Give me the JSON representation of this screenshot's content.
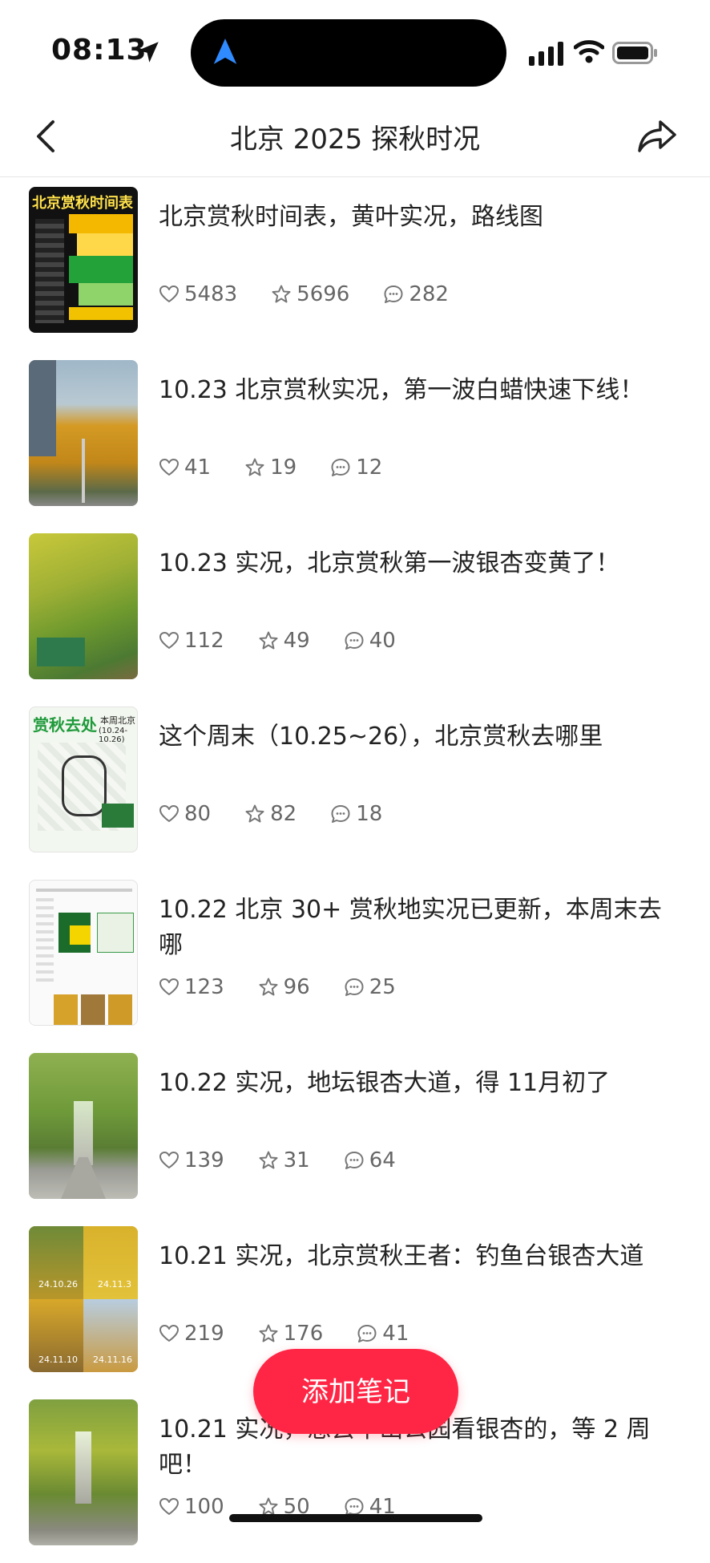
{
  "status_bar": {
    "time": "08:13"
  },
  "nav": {
    "title": "北京 2025 探秋时况"
  },
  "thumb_labels": {
    "schedule": "北京赏秋时间表",
    "route": "赏秋去处",
    "route_sub": "本周北京",
    "route_date": "(10.24-10.26)",
    "photo_dates": [
      "24.10.26",
      "24.11.3",
      "24.11.10",
      "24.11.16"
    ]
  },
  "notes": [
    {
      "title": "北京赏秋时间表，黄叶实况，路线图",
      "likes": "5483",
      "stars": "5696",
      "comments": "282"
    },
    {
      "title": "10.23 北京赏秋实况，第一波白蜡快速下线！",
      "likes": "41",
      "stars": "19",
      "comments": "12"
    },
    {
      "title": "10.23 实况，北京赏秋第一波银杏变黄了！",
      "likes": "112",
      "stars": "49",
      "comments": "40"
    },
    {
      "title": "这个周末（10.25~26），北京赏秋去哪里",
      "likes": "80",
      "stars": "82",
      "comments": "18"
    },
    {
      "title": "10.22 北京 30+ 赏秋地实况已更新，本周末去哪",
      "likes": "123",
      "stars": "96",
      "comments": "25"
    },
    {
      "title": "10.22 实况，地坛银杏大道，得 11月初了",
      "likes": "139",
      "stars": "31",
      "comments": "64"
    },
    {
      "title": "10.21 实况，北京赏秋王者：钓鱼台银杏大道",
      "likes": "219",
      "stars": "176",
      "comments": "41"
    },
    {
      "title": "10.21 实况，想去中山公园看银杏的，等 2 周吧！",
      "likes": "100",
      "stars": "50",
      "comments": "41"
    }
  ],
  "add_note_label": "添加笔记",
  "colors": {
    "accent": "#ff2645",
    "text": "#222222",
    "meta": "#666666"
  }
}
